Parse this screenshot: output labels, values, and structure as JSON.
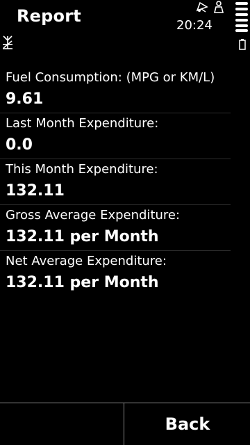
{
  "status_bar": {
    "app_title": "Report",
    "time": "20:24"
  },
  "report": {
    "items": [
      {
        "label": "Fuel Consumption: (MPG or KM/L)",
        "value": "9.61"
      },
      {
        "label": "Last Month Expenditure:",
        "value": "0.0"
      },
      {
        "label": "This Month Expenditure:",
        "value": "132.11"
      },
      {
        "label": "Gross Average Expenditure:",
        "value": "132.11 per Month"
      },
      {
        "label": "Net Average Expenditure:",
        "value": "132.11 per Month"
      }
    ]
  },
  "softkeys": {
    "left_label": "",
    "right_label": "Back"
  },
  "icons": {
    "notification": "notification-bell-icon",
    "profile": "person-icon",
    "network": "network-antenna-icon",
    "signal": "signal-strength-icon",
    "battery": "battery-icon"
  }
}
